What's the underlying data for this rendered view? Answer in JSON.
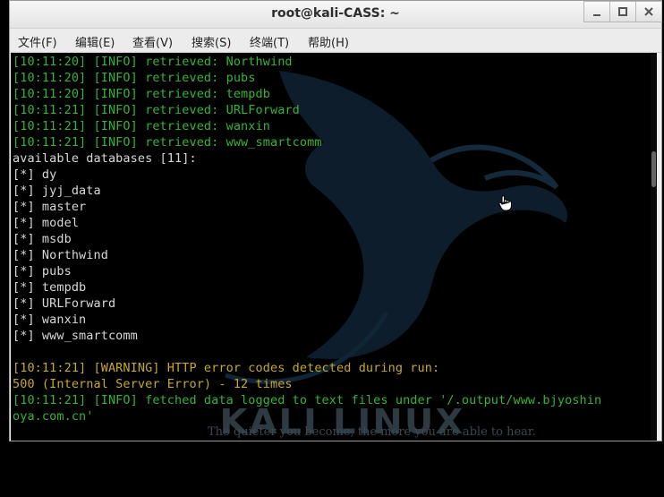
{
  "window": {
    "title": "root@kali-CASS: ~"
  },
  "menu": [
    "文件(F)",
    "编辑(E)",
    "查看(V)",
    "搜索(S)",
    "终端(T)",
    "帮助(H)"
  ],
  "terminal": {
    "lines": [
      {
        "text": "[10:11:20] [INFO] retrieved: Northwind",
        "color": "green"
      },
      {
        "text": "[10:11:20] [INFO] retrieved: pubs",
        "color": "green"
      },
      {
        "text": "[10:11:20] [INFO] retrieved: tempdb",
        "color": "green"
      },
      {
        "text": "[10:11:21] [INFO] retrieved: URLForward",
        "color": "green"
      },
      {
        "text": "[10:11:21] [INFO] retrieved: wanxin",
        "color": "green"
      },
      {
        "text": "[10:11:21] [INFO] retrieved: www_smartcomm",
        "color": "green"
      },
      {
        "text": "available databases [11]:",
        "color": "white"
      },
      {
        "text": "[*] dy",
        "color": "white"
      },
      {
        "text": "[*] jyj_data",
        "color": "white"
      },
      {
        "text": "[*] master",
        "color": "white"
      },
      {
        "text": "[*] model",
        "color": "white"
      },
      {
        "text": "[*] msdb",
        "color": "white"
      },
      {
        "text": "[*] Northwind",
        "color": "white"
      },
      {
        "text": "[*] pubs",
        "color": "white"
      },
      {
        "text": "[*] tempdb",
        "color": "white"
      },
      {
        "text": "[*] URLForward",
        "color": "white"
      },
      {
        "text": "[*] wanxin",
        "color": "white"
      },
      {
        "text": "[*] www_smartcomm",
        "color": "white"
      },
      {
        "text": "",
        "color": "white"
      },
      {
        "text": "[10:11:21] [WARNING] HTTP error codes detected during run:",
        "color": "yellow"
      },
      {
        "text": "500 (Internal Server Error) - 12 times",
        "color": "yellow"
      },
      {
        "text": "[10:11:21] [INFO] fetched data logged to text files under '/.output/www.bjyoshin",
        "color": "green"
      },
      {
        "text": "oya.com.cn'",
        "color": "green"
      }
    ],
    "watermark": "KALI LINUX",
    "motto": "The quieter you become, the more you are able to hear."
  },
  "colors": {
    "green": "#34b434",
    "white": "#d8d8d8",
    "yellow": "#c6a82a"
  }
}
